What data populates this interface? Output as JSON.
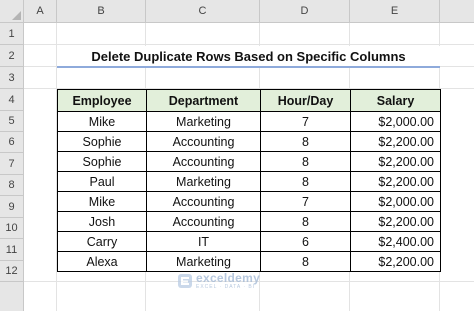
{
  "columns": [
    "A",
    "B",
    "C",
    "D",
    "E"
  ],
  "rows": [
    "1",
    "2",
    "3",
    "4",
    "5",
    "6",
    "7",
    "8",
    "9",
    "10",
    "11",
    "12"
  ],
  "title": "Delete Duplicate Rows Based on Specific Columns",
  "table": {
    "headers": [
      "Employee",
      "Department",
      "Hour/Day",
      "Salary"
    ],
    "rows": [
      [
        "Mike",
        "Marketing",
        "7",
        "$2,000.00"
      ],
      [
        "Sophie",
        "Accounting",
        "8",
        "$2,200.00"
      ],
      [
        "Sophie",
        "Accounting",
        "8",
        "$2,200.00"
      ],
      [
        "Paul",
        "Marketing",
        "8",
        "$2,200.00"
      ],
      [
        "Mike",
        "Accounting",
        "7",
        "$2,000.00"
      ],
      [
        "Josh",
        "Accounting",
        "8",
        "$2,200.00"
      ],
      [
        "Carry",
        "IT",
        "6",
        "$2,400.00"
      ],
      [
        "Alexa",
        "Marketing",
        "8",
        "$2,200.00"
      ]
    ]
  },
  "watermark": {
    "name": "exceldemy",
    "tagline": "EXCEL · DATA · BI"
  },
  "colors": {
    "header_fill": "#e2efda",
    "title_underline": "#8eaadb",
    "grid_header": "#e6e6e6"
  }
}
